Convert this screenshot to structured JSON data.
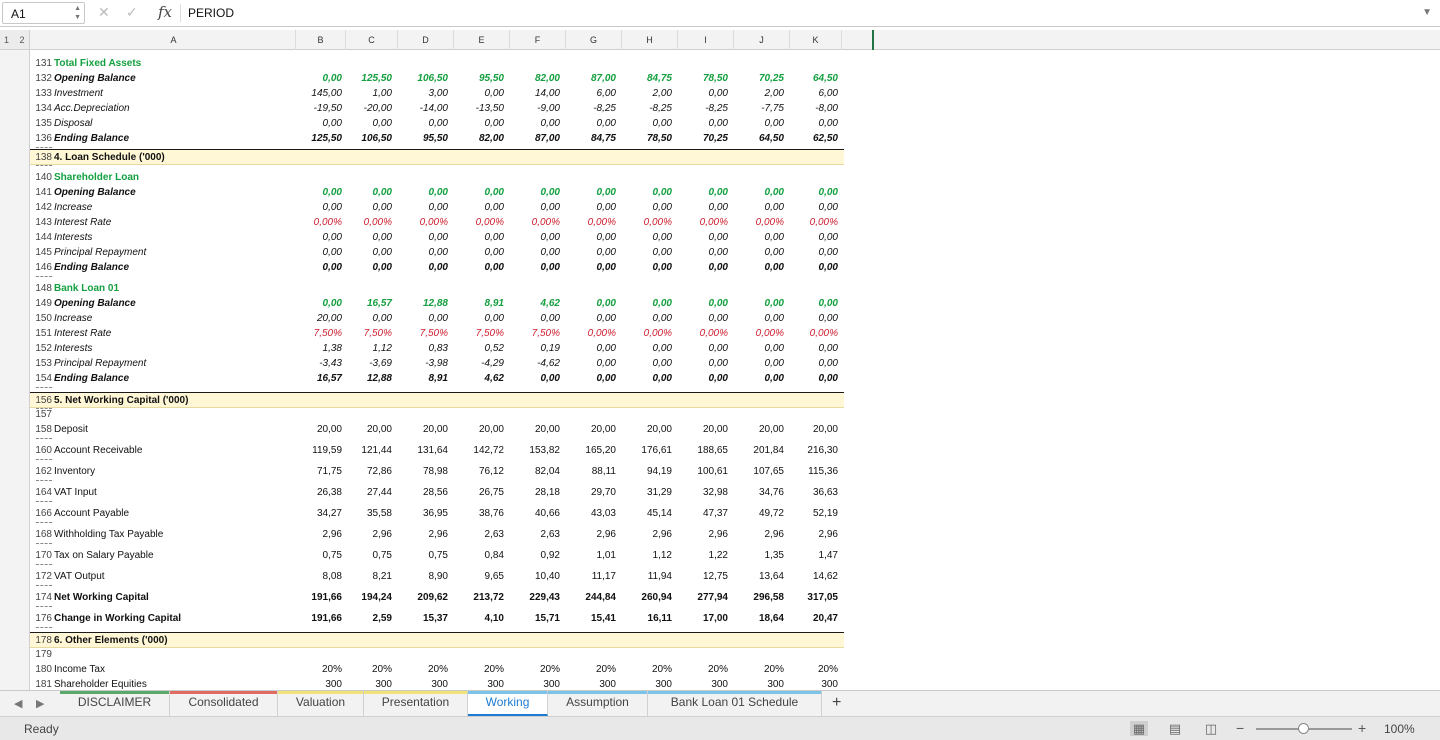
{
  "formula_bar": {
    "name_box": "A1",
    "fx_label": "fx",
    "formula_value": "PERIOD",
    "cancel_icon": "close-icon",
    "enter_icon": "check-icon"
  },
  "outline_levels": "1 2",
  "columns": [
    "A",
    "B",
    "C",
    "D",
    "E",
    "F",
    "G",
    "H",
    "I",
    "J",
    "K"
  ],
  "rows": [
    {
      "num": "131",
      "label": "Total Fixed Assets",
      "style": "green",
      "values": []
    },
    {
      "num": "132",
      "label": "Opening Balance",
      "style": "bolditalic",
      "vstyle": "green",
      "values": [
        "0,00",
        "125,50",
        "106,50",
        "95,50",
        "82,00",
        "87,00",
        "84,75",
        "78,50",
        "70,25",
        "64,50"
      ]
    },
    {
      "num": "133",
      "label": "Investment",
      "style": "italic",
      "vstyle": "italic",
      "values": [
        "145,00",
        "1,00",
        "3,00",
        "0,00",
        "14,00",
        "6,00",
        "2,00",
        "0,00",
        "2,00",
        "6,00"
      ]
    },
    {
      "num": "134",
      "label": "Acc.Depreciation",
      "style": "italic",
      "vstyle": "italic",
      "values": [
        "-19,50",
        "-20,00",
        "-14,00",
        "-13,50",
        "-9,00",
        "-8,25",
        "-8,25",
        "-8,25",
        "-7,75",
        "-8,00"
      ]
    },
    {
      "num": "135",
      "label": "Disposal",
      "style": "italic",
      "vstyle": "italic",
      "values": [
        "0,00",
        "0,00",
        "0,00",
        "0,00",
        "0,00",
        "0,00",
        "0,00",
        "0,00",
        "0,00",
        "0,00"
      ]
    },
    {
      "num": "136",
      "label": "Ending Balance",
      "style": "bolditalic",
      "vstyle": "bolditalic",
      "values": [
        "125,50",
        "106,50",
        "95,50",
        "82,00",
        "87,00",
        "84,75",
        "78,50",
        "70,25",
        "64,50",
        "62,50"
      ]
    },
    {
      "num": "138",
      "label": "4. Loan Schedule ('000)",
      "style": "section",
      "values": []
    },
    {
      "num": "140",
      "label": "Shareholder Loan",
      "style": "green",
      "values": []
    },
    {
      "num": "141",
      "label": "Opening Balance",
      "style": "bolditalic",
      "vstyle": "green",
      "values": [
        "0,00",
        "0,00",
        "0,00",
        "0,00",
        "0,00",
        "0,00",
        "0,00",
        "0,00",
        "0,00",
        "0,00"
      ]
    },
    {
      "num": "142",
      "label": "Increase",
      "style": "italic",
      "vstyle": "italic",
      "values": [
        "0,00",
        "0,00",
        "0,00",
        "0,00",
        "0,00",
        "0,00",
        "0,00",
        "0,00",
        "0,00",
        "0,00"
      ]
    },
    {
      "num": "143",
      "label": "Interest Rate",
      "style": "italic",
      "vstyle": "red",
      "values": [
        "0,00%",
        "0,00%",
        "0,00%",
        "0,00%",
        "0,00%",
        "0,00%",
        "0,00%",
        "0,00%",
        "0,00%",
        "0,00%"
      ]
    },
    {
      "num": "144",
      "label": "Interests",
      "style": "italic",
      "vstyle": "italic",
      "values": [
        "0,00",
        "0,00",
        "0,00",
        "0,00",
        "0,00",
        "0,00",
        "0,00",
        "0,00",
        "0,00",
        "0,00"
      ]
    },
    {
      "num": "145",
      "label": "Principal Repayment",
      "style": "italic",
      "vstyle": "italic",
      "values": [
        "0,00",
        "0,00",
        "0,00",
        "0,00",
        "0,00",
        "0,00",
        "0,00",
        "0,00",
        "0,00",
        "0,00"
      ]
    },
    {
      "num": "146",
      "label": "Ending Balance",
      "style": "bolditalic",
      "vstyle": "bolditalic",
      "values": [
        "0,00",
        "0,00",
        "0,00",
        "0,00",
        "0,00",
        "0,00",
        "0,00",
        "0,00",
        "0,00",
        "0,00"
      ]
    },
    {
      "num": "148",
      "label": "Bank Loan 01",
      "style": "green",
      "values": []
    },
    {
      "num": "149",
      "label": "Opening Balance",
      "style": "bolditalic",
      "vstyle": "green",
      "values": [
        "0,00",
        "16,57",
        "12,88",
        "8,91",
        "4,62",
        "0,00",
        "0,00",
        "0,00",
        "0,00",
        "0,00"
      ]
    },
    {
      "num": "150",
      "label": "Increase",
      "style": "italic",
      "vstyle": "italic",
      "values": [
        "20,00",
        "0,00",
        "0,00",
        "0,00",
        "0,00",
        "0,00",
        "0,00",
        "0,00",
        "0,00",
        "0,00"
      ]
    },
    {
      "num": "151",
      "label": "Interest Rate",
      "style": "italic",
      "vstyle": "red",
      "values": [
        "7,50%",
        "7,50%",
        "7,50%",
        "7,50%",
        "7,50%",
        "0,00%",
        "0,00%",
        "0,00%",
        "0,00%",
        "0,00%"
      ]
    },
    {
      "num": "152",
      "label": "Interests",
      "style": "italic",
      "vstyle": "italic",
      "values": [
        "1,38",
        "1,12",
        "0,83",
        "0,52",
        "0,19",
        "0,00",
        "0,00",
        "0,00",
        "0,00",
        "0,00"
      ]
    },
    {
      "num": "153",
      "label": "Principal Repayment",
      "style": "italic",
      "vstyle": "italic",
      "values": [
        "-3,43",
        "-3,69",
        "-3,98",
        "-4,29",
        "-4,62",
        "0,00",
        "0,00",
        "0,00",
        "0,00",
        "0,00"
      ]
    },
    {
      "num": "154",
      "label": "Ending Balance",
      "style": "bolditalic",
      "vstyle": "bolditalic",
      "values": [
        "16,57",
        "12,88",
        "8,91",
        "4,62",
        "0,00",
        "0,00",
        "0,00",
        "0,00",
        "0,00",
        "0,00"
      ]
    },
    {
      "num": "156",
      "label": "5. Net Working Capital ('000)",
      "style": "section",
      "values": []
    },
    {
      "num": "157",
      "label": "",
      "style": "plain",
      "values": []
    },
    {
      "num": "158",
      "label": "Deposit",
      "style": "plain",
      "vstyle": "plain",
      "values": [
        "20,00",
        "20,00",
        "20,00",
        "20,00",
        "20,00",
        "20,00",
        "20,00",
        "20,00",
        "20,00",
        "20,00"
      ]
    },
    {
      "num": "160",
      "label": "Account Receivable",
      "style": "plain",
      "vstyle": "plain",
      "values": [
        "119,59",
        "121,44",
        "131,64",
        "142,72",
        "153,82",
        "165,20",
        "176,61",
        "188,65",
        "201,84",
        "216,30"
      ]
    },
    {
      "num": "162",
      "label": "Inventory",
      "style": "plain",
      "vstyle": "plain",
      "values": [
        "71,75",
        "72,86",
        "78,98",
        "76,12",
        "82,04",
        "88,11",
        "94,19",
        "100,61",
        "107,65",
        "115,36"
      ]
    },
    {
      "num": "164",
      "label": "VAT Input",
      "style": "plain",
      "vstyle": "plain",
      "values": [
        "26,38",
        "27,44",
        "28,56",
        "26,75",
        "28,18",
        "29,70",
        "31,29",
        "32,98",
        "34,76",
        "36,63"
      ]
    },
    {
      "num": "166",
      "label": "Account Payable",
      "style": "plain",
      "vstyle": "plain",
      "values": [
        "34,27",
        "35,58",
        "36,95",
        "38,76",
        "40,66",
        "43,03",
        "45,14",
        "47,37",
        "49,72",
        "52,19"
      ]
    },
    {
      "num": "168",
      "label": "Withholding Tax Payable",
      "style": "plain",
      "vstyle": "plain",
      "values": [
        "2,96",
        "2,96",
        "2,96",
        "2,63",
        "2,63",
        "2,96",
        "2,96",
        "2,96",
        "2,96",
        "2,96"
      ]
    },
    {
      "num": "170",
      "label": "Tax on Salary Payable",
      "style": "plain",
      "vstyle": "plain",
      "values": [
        "0,75",
        "0,75",
        "0,75",
        "0,84",
        "0,92",
        "1,01",
        "1,12",
        "1,22",
        "1,35",
        "1,47"
      ]
    },
    {
      "num": "172",
      "label": "VAT Output",
      "style": "plain",
      "vstyle": "plain",
      "values": [
        "8,08",
        "8,21",
        "8,90",
        "9,65",
        "10,40",
        "11,17",
        "11,94",
        "12,75",
        "13,64",
        "14,62"
      ]
    },
    {
      "num": "174",
      "label": "Net Working Capital",
      "style": "bold",
      "vstyle": "bold",
      "values": [
        "191,66",
        "194,24",
        "209,62",
        "213,72",
        "229,43",
        "244,84",
        "260,94",
        "277,94",
        "296,58",
        "317,05"
      ]
    },
    {
      "num": "176",
      "label": "Change in Working Capital",
      "style": "bold",
      "vstyle": "bold",
      "values": [
        "191,66",
        "2,59",
        "15,37",
        "4,10",
        "15,71",
        "15,41",
        "16,11",
        "17,00",
        "18,64",
        "20,47"
      ]
    },
    {
      "num": "178",
      "label": "6. Other Elements ('000)",
      "style": "section",
      "values": []
    },
    {
      "num": "179",
      "label": "",
      "style": "plain",
      "values": []
    },
    {
      "num": "180",
      "label": "Income Tax",
      "style": "plain",
      "vstyle": "plain",
      "values": [
        "20%",
        "20%",
        "20%",
        "20%",
        "20%",
        "20%",
        "20%",
        "20%",
        "20%",
        "20%"
      ]
    },
    {
      "num": "181",
      "label": "Shareholder Equities",
      "style": "plain",
      "vstyle": "plain",
      "values": [
        "300",
        "300",
        "300",
        "300",
        "300",
        "300",
        "300",
        "300",
        "300",
        "300"
      ]
    }
  ],
  "sheet_tabs": [
    {
      "label": "DISCLAIMER",
      "color": "#5aa96b"
    },
    {
      "label": "Consolidated",
      "color": "#e06b63"
    },
    {
      "label": "Valuation",
      "color": "#f2e27a"
    },
    {
      "label": "Presentation",
      "color": "#f2e27a"
    },
    {
      "label": "Working",
      "color": "#7cc3e8",
      "active": true
    },
    {
      "label": "Assumption",
      "color": "#7cc3e8"
    },
    {
      "label": "Bank Loan 01 Schedule",
      "color": "#7cc3e8"
    }
  ],
  "add_sheet": "+",
  "status": {
    "text": "Ready",
    "zoom": "100%",
    "zoom_minus": "−",
    "zoom_plus": "+"
  }
}
